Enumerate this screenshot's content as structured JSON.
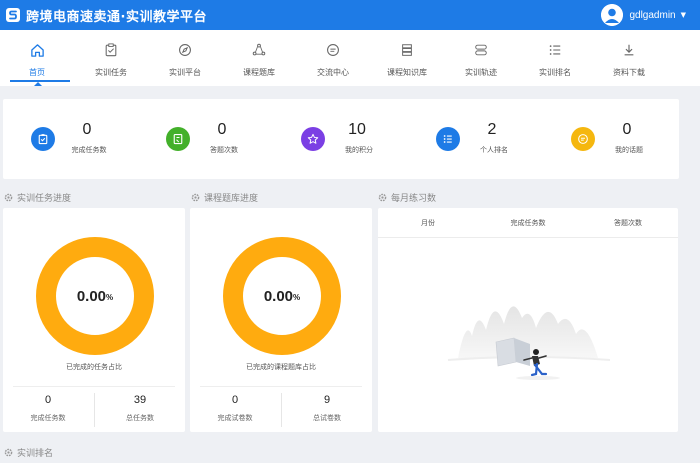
{
  "header": {
    "title": "跨境电商速卖通·实训教学平台",
    "username": "gdlgadmin",
    "bg_color": "#1e7be6"
  },
  "nav": [
    {
      "label": "首页",
      "icon": "home-icon",
      "active": true
    },
    {
      "label": "实训任务",
      "icon": "task-check-icon",
      "active": false
    },
    {
      "label": "实训平台",
      "icon": "compass-icon",
      "active": false
    },
    {
      "label": "课程题库",
      "icon": "cycle-icon",
      "active": false
    },
    {
      "label": "交流中心",
      "icon": "chat-icon",
      "active": false
    },
    {
      "label": "课程知识库",
      "icon": "books-icon",
      "active": false
    },
    {
      "label": "实训轨迹",
      "icon": "track-icon",
      "active": false
    },
    {
      "label": "实训排名",
      "icon": "list-icon",
      "active": false
    },
    {
      "label": "资料下载",
      "icon": "download-icon",
      "active": false
    }
  ],
  "stats": [
    {
      "value": "0",
      "label": "完成任务数",
      "color": "#1e7be6",
      "icon": "clipboard-icon"
    },
    {
      "value": "0",
      "label": "答题次数",
      "color": "#43b02a",
      "icon": "document-icon"
    },
    {
      "value": "10",
      "label": "我的积分",
      "color": "#7b3fe4",
      "icon": "star-icon"
    },
    {
      "value": "2",
      "label": "个人排名",
      "color": "#1e7be6",
      "icon": "ranking-list-icon"
    },
    {
      "value": "0",
      "label": "我的话题",
      "color": "#f5b70f",
      "icon": "comment-icon"
    }
  ],
  "sections": {
    "task_progress": "实训任务进度",
    "question_progress": "课程题库进度",
    "monthly": "每月练习数",
    "ranking": "实训排名"
  },
  "task_card": {
    "percent": "0.00",
    "unit": "%",
    "caption": "已完成的任务占比",
    "left_value": "0",
    "left_label": "完成任务数",
    "right_value": "39",
    "right_label": "总任务数",
    "ring_color": "#ffab0f"
  },
  "question_card": {
    "percent": "0.00",
    "unit": "%",
    "caption": "已完成的课程题库占比",
    "left_value": "0",
    "left_label": "完成试卷数",
    "right_value": "9",
    "right_label": "总试卷数",
    "ring_color": "#ffab0f"
  },
  "monthly_table": {
    "columns": [
      "月份",
      "完成任务数",
      "答题次数"
    ],
    "rows": []
  }
}
